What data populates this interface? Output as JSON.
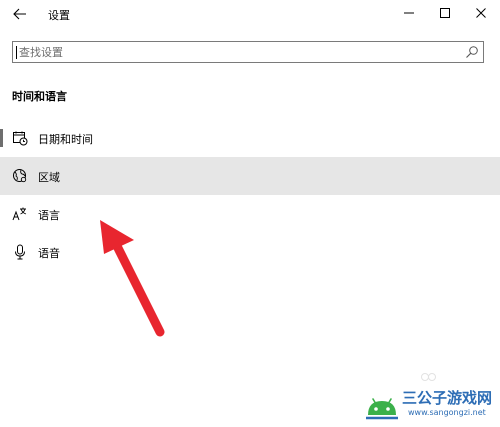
{
  "window": {
    "title": "设置"
  },
  "search": {
    "placeholder": "查找设置"
  },
  "section": {
    "heading": "时间和语言"
  },
  "nav": {
    "items": [
      {
        "label": "日期和时间",
        "icon": "calendar-clock-icon",
        "selected": false,
        "indicator": true
      },
      {
        "label": "区域",
        "icon": "globe-region-icon",
        "selected": true,
        "indicator": false
      },
      {
        "label": "语言",
        "icon": "language-icon",
        "selected": false,
        "indicator": false
      },
      {
        "label": "语音",
        "icon": "microphone-icon",
        "selected": false,
        "indicator": false
      }
    ]
  },
  "annotation": {
    "arrow_color": "#e8262f"
  },
  "watermark": {
    "title": "三公子游戏网",
    "url": "www.sangongzi.net",
    "color": "#2d6db5",
    "logo_color": "#3bb04a"
  },
  "colors": {
    "selected_bg": "#e6e6e6",
    "indicator": "#6e6e6e",
    "search_border": "#7a7a7a"
  }
}
